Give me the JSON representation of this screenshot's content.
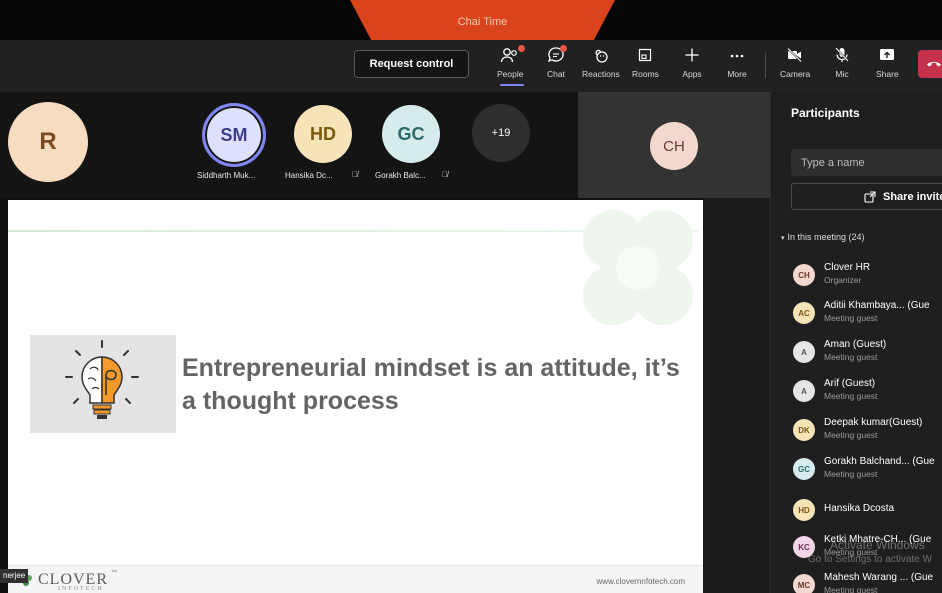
{
  "meeting": {
    "title": "Chai Time"
  },
  "toolbar": {
    "request_control": "Request control",
    "items": [
      {
        "label": "People",
        "icon": "people-icon"
      },
      {
        "label": "Chat",
        "icon": "chat-icon"
      },
      {
        "label": "Reactions",
        "icon": "reactions-icon"
      },
      {
        "label": "Rooms",
        "icon": "rooms-icon"
      },
      {
        "label": "Apps",
        "icon": "plus-icon"
      },
      {
        "label": "More",
        "icon": "more-icon"
      },
      {
        "label": "Camera",
        "icon": "camera-off-icon"
      },
      {
        "label": "Mic",
        "icon": "mic-off-icon"
      },
      {
        "label": "Share",
        "icon": "share-icon"
      }
    ],
    "leave_icon": "hangup-icon"
  },
  "strip": {
    "r_initial": "R",
    "tiles": [
      {
        "initials": "SM",
        "name": "Siddharth Muk..."
      },
      {
        "initials": "HD",
        "name": "Hansika Dc..."
      },
      {
        "initials": "GC",
        "name": "Gorakh Balc..."
      }
    ],
    "overflow": "+19",
    "ch_initials": "CH"
  },
  "slide": {
    "heading": "Entrepreneurial mindset is an attitude, it’s a thought process",
    "logo": "CLOVER",
    "logo_sub": "INFOTECH",
    "logo_mark": "™",
    "url": "www.clovernnfotech.com",
    "presenter_tag": "nerjee"
  },
  "panel": {
    "title": "Participants",
    "search_placeholder": "Type a name",
    "share_invite": "Share invite",
    "section": "In this meeting (24)",
    "participants": [
      {
        "initials": "CH",
        "name": "Clover HR",
        "role": "Organizer",
        "color": "#f3d8d0",
        "text": "#6b3a2c"
      },
      {
        "initials": "AC",
        "name": "Aditii Khambaya... (Gue",
        "role": "Meeting guest",
        "color": "#f6e3b8",
        "text": "#7a5a10"
      },
      {
        "initials": "A",
        "name": "Aman (Guest)",
        "role": "Meeting guest",
        "color": "#e6e6e6",
        "text": "#555555"
      },
      {
        "initials": "A",
        "name": "Arif (Guest)",
        "role": "Meeting guest",
        "color": "#e6e6e6",
        "text": "#555555"
      },
      {
        "initials": "DK",
        "name": "Deepak kumar(Guest)",
        "role": "Meeting guest",
        "color": "#f6e3b8",
        "text": "#7a5a10"
      },
      {
        "initials": "GC",
        "name": "Gorakh Balchand... (Gue",
        "role": "Meeting guest",
        "color": "#d6ecec",
        "text": "#2d6a6a"
      },
      {
        "initials": "HD",
        "name": "Hansika Dcosta",
        "role": "",
        "color": "#f6e3b8",
        "text": "#7a5a10"
      },
      {
        "initials": "KC",
        "name": "Ketki Mhatre-CH... (Gue",
        "role": "Meeting guest",
        "color": "#f0d6e6",
        "text": "#7a2c5a"
      },
      {
        "initials": "MC",
        "name": "Mahesh Warang ... (Gue",
        "role": "Meeting guest",
        "color": "#f3d8d0",
        "text": "#6b3a2c"
      }
    ]
  },
  "os_watermark": {
    "line1": "Activate Windows",
    "line2": "Go to Settings to activate W"
  },
  "colors": {
    "accent": "#7f85f5",
    "leave": "#c4314b",
    "title_tab": "#d9441c"
  }
}
